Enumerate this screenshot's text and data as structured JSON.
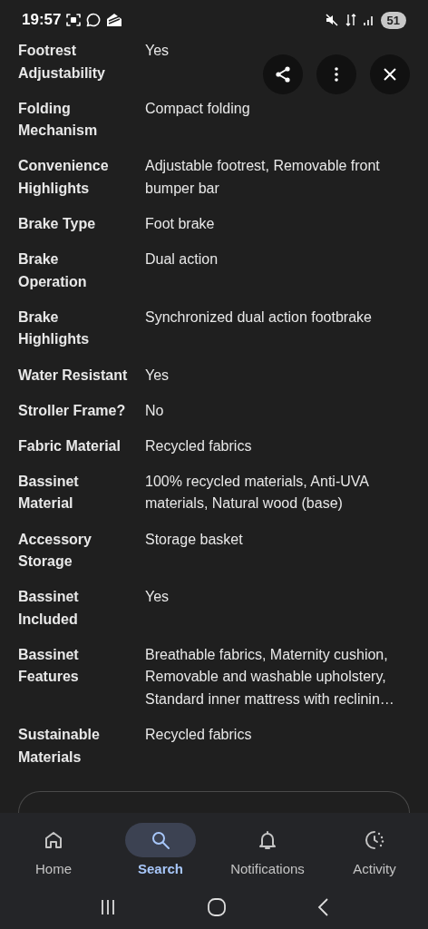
{
  "status_bar": {
    "time": "19:57",
    "battery": "51"
  },
  "specs": [
    {
      "label": [
        "Footrest",
        "Adjustability"
      ],
      "value": [
        "Yes"
      ]
    },
    {
      "label": [
        "Folding",
        "Mechanism"
      ],
      "value": [
        "Compact folding"
      ]
    },
    {
      "label": [
        "Convenience",
        "Highlights"
      ],
      "value": [
        "Adjustable footrest, Removable front",
        "bumper bar"
      ]
    },
    {
      "label": [
        "Brake Type"
      ],
      "value": [
        "Foot brake"
      ]
    },
    {
      "label": [
        "Brake",
        "Operation"
      ],
      "value": [
        "Dual action"
      ]
    },
    {
      "label": [
        "Brake",
        "Highlights"
      ],
      "value": [
        "Synchronized dual action footbrake"
      ]
    },
    {
      "label": [
        "Water Resistant"
      ],
      "value": [
        "Yes"
      ]
    },
    {
      "label": [
        "Stroller Frame?"
      ],
      "value": [
        "No"
      ]
    },
    {
      "label": [
        "Fabric Material"
      ],
      "value": [
        "Recycled fabrics"
      ]
    },
    {
      "label": [
        "Bassinet",
        "Material"
      ],
      "value": [
        "100% recycled materials, Anti-UVA",
        "materials, Natural wood (base)"
      ]
    },
    {
      "label": [
        "Accessory",
        "Storage"
      ],
      "value": [
        "Storage basket"
      ]
    },
    {
      "label": [
        "Bassinet",
        "Included"
      ],
      "value": [
        "Yes"
      ]
    },
    {
      "label": [
        "Bassinet",
        "Features"
      ],
      "value": [
        "Breathable fabrics, Maternity cushion,",
        "Removable and washable upholstery,",
        "Standard inner mattress with reclinin…"
      ]
    },
    {
      "label": [
        "Sustainable",
        "Materials"
      ],
      "value": [
        "Recycled fabrics"
      ]
    }
  ],
  "nav": [
    {
      "kind": "home",
      "label": "Home",
      "selected": false
    },
    {
      "kind": "search",
      "label": "Search",
      "selected": true
    },
    {
      "kind": "bell",
      "label": "Notifications",
      "selected": false
    },
    {
      "kind": "activity",
      "label": "Activity",
      "selected": false
    }
  ]
}
